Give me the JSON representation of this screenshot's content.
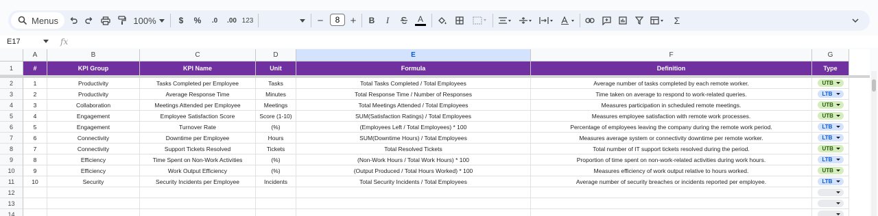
{
  "toolbar": {
    "search_label": "Menus",
    "zoom": "100%",
    "currency": "$",
    "percent": "%",
    "dec_decrease": ".0",
    "dec_increase": ".00",
    "number_format": "123",
    "font_size": "8",
    "minus": "−",
    "plus": "+",
    "bold": "B",
    "italic": "I",
    "underline_text": "A",
    "sigma": "Σ"
  },
  "formula_bar": {
    "name_box": "E17",
    "fx": "fx"
  },
  "columns": [
    "A",
    "B",
    "C",
    "D",
    "E",
    "F",
    "G"
  ],
  "header_row": {
    "row_number": "1",
    "cells": [
      "#",
      "KPI Group",
      "KPI Name",
      "Unit",
      "Formula",
      "Definition",
      "Type"
    ]
  },
  "rows": [
    {
      "row": "2",
      "cells": [
        "1",
        "Productivity",
        "Tasks Completed per Employee",
        "Tasks",
        "Total Tasks Completed / Total Employees",
        "Average number of tasks completed by each remote worker."
      ],
      "type": "UTB"
    },
    {
      "row": "3",
      "cells": [
        "2",
        "Productivity",
        "Average Response Time",
        "Minutes",
        "Total Response Time / Number of Responses",
        "Time taken on average to respond to work-related queries."
      ],
      "type": "LTB"
    },
    {
      "row": "4",
      "cells": [
        "3",
        "Collaboration",
        "Meetings Attended per Employee",
        "Meetings",
        "Total Meetings Attended / Total Employees",
        "Measures participation in scheduled remote meetings."
      ],
      "type": "UTB"
    },
    {
      "row": "5",
      "cells": [
        "4",
        "Engagement",
        "Employee Satisfaction Score",
        "Score (1-10)",
        "SUM(Satisfaction Ratings) / Total Employees",
        "Measures employee satisfaction with remote work processes."
      ],
      "type": "UTB"
    },
    {
      "row": "6",
      "cells": [
        "5",
        "Engagement",
        "Turnover Rate",
        "(%)",
        "(Employees Left / Total Employees) * 100",
        "Percentage of employees leaving the company during the remote work period."
      ],
      "type": "LTB"
    },
    {
      "row": "7",
      "cells": [
        "6",
        "Connectivity",
        "Downtime per Employee",
        "Hours",
        "SUM(Downtime Hours) / Total Employees",
        "Measures average system or connectivity downtime per remote worker."
      ],
      "type": "LTB"
    },
    {
      "row": "8",
      "cells": [
        "7",
        "Connectivity",
        "Support Tickets Resolved",
        "Tickets",
        "Total Resolved Tickets",
        "Total number of IT support tickets resolved during the period."
      ],
      "type": "UTB"
    },
    {
      "row": "9",
      "cells": [
        "8",
        "Efficiency",
        "Time Spent on Non-Work Activities",
        "(%)",
        "(Non-Work Hours / Total Work Hours) * 100",
        "Proportion of time spent on non-work-related activities during work hours."
      ],
      "type": "LTB"
    },
    {
      "row": "10",
      "cells": [
        "9",
        "Efficiency",
        "Work Output Efficiency",
        "(%)",
        "(Output Produced / Total Hours Worked) * 100",
        "Measures efficiency of work output relative to hours worked."
      ],
      "type": "UTB"
    },
    {
      "row": "11",
      "cells": [
        "10",
        "Security",
        "Security Incidents per Employee",
        "Incidents",
        "Total Security Incidents / Total Employees",
        "Average number of security breaches or incidents reported per employee."
      ],
      "type": "LTB"
    },
    {
      "row": "12",
      "cells": [
        "",
        "",
        "",
        "",
        "",
        ""
      ],
      "type": ""
    },
    {
      "row": "13",
      "cells": [
        "",
        "",
        "",
        "",
        "",
        ""
      ],
      "type": ""
    },
    {
      "row": "14",
      "cells": [
        "",
        "",
        "",
        "",
        "",
        ""
      ],
      "type": ""
    }
  ],
  "colors": {
    "header_purple": "#7030a0",
    "utb_chip": "#d4edbc",
    "ltb_chip": "#d3e3fd",
    "empty_chip": "#e8eaed",
    "selected_column": "#d3e3fd"
  }
}
